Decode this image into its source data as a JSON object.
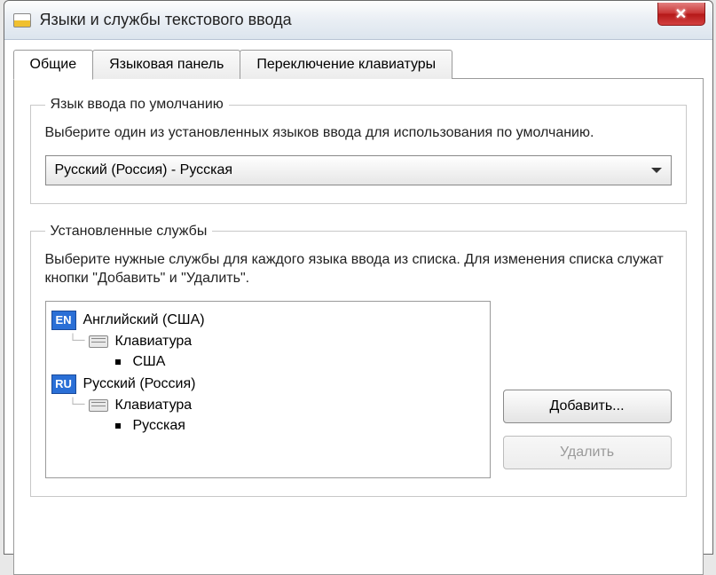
{
  "window": {
    "title": "Языки и службы текстового ввода"
  },
  "tabs": {
    "general": "Общие",
    "langbar": "Языковая панель",
    "switch": "Переключение клавиатуры"
  },
  "default_lang": {
    "legend": "Язык ввода по умолчанию",
    "desc": "Выберите один из установленных языков ввода для использования по умолчанию.",
    "selected": "Русский (Россия) - Русская"
  },
  "services": {
    "legend": "Установленные службы",
    "desc": "Выберите нужные службы для каждого языка ввода из списка. Для изменения списка служат кнопки \"Добавить\" и \"Удалить\".",
    "keyboard_label": "Клавиатура",
    "langs": [
      {
        "badge": "EN",
        "name": "Английский (США)",
        "layout": "США"
      },
      {
        "badge": "RU",
        "name": "Русский (Россия)",
        "layout": "Русская"
      }
    ]
  },
  "buttons": {
    "add": "Добавить...",
    "delete": "Удалить"
  }
}
